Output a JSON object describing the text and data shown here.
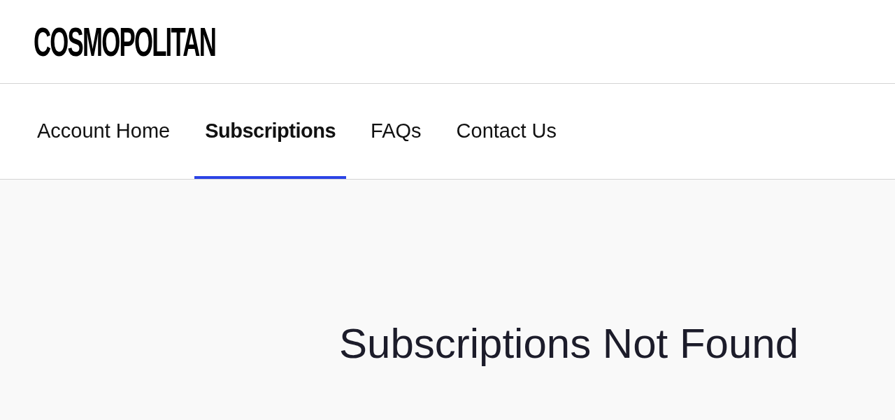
{
  "logo": "COSMOPOLITAN",
  "tabs": [
    {
      "label": "Account Home",
      "selected": false
    },
    {
      "label": "Subscriptions",
      "selected": true
    },
    {
      "label": "FAQs",
      "selected": false
    },
    {
      "label": "Contact Us",
      "selected": false
    }
  ],
  "heading": "Subscriptions Not Found"
}
